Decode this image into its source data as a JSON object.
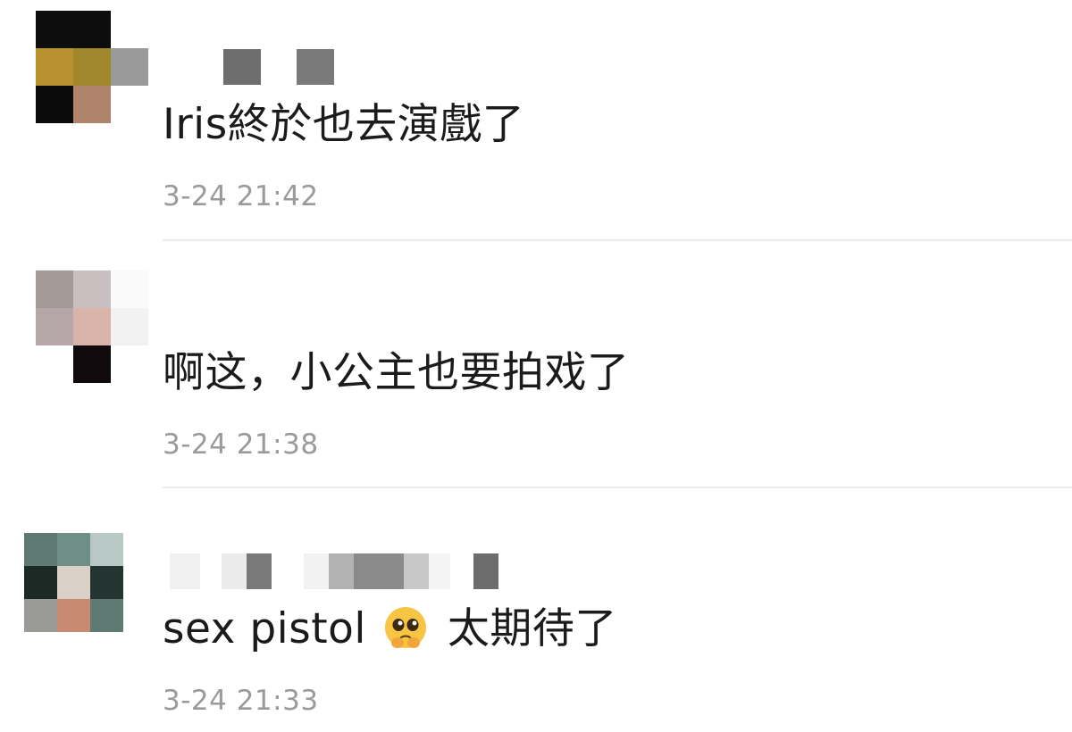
{
  "comments": [
    {
      "text": "Iris終於也去演戲了",
      "time": "3-24 21:42"
    },
    {
      "text": "啊这，小公主也要拍戏了",
      "time": "3-24 21:38"
    },
    {
      "text_before_emoji": "sex pistol",
      "emoji": "pleading-face-emoji",
      "text_after_emoji": "太期待了",
      "time": "3-24 21:33"
    }
  ],
  "colors": {
    "text": "#1b1b1b",
    "timestamp": "#9a9a9a",
    "divider": "#ececec",
    "background": "#ffffff"
  }
}
